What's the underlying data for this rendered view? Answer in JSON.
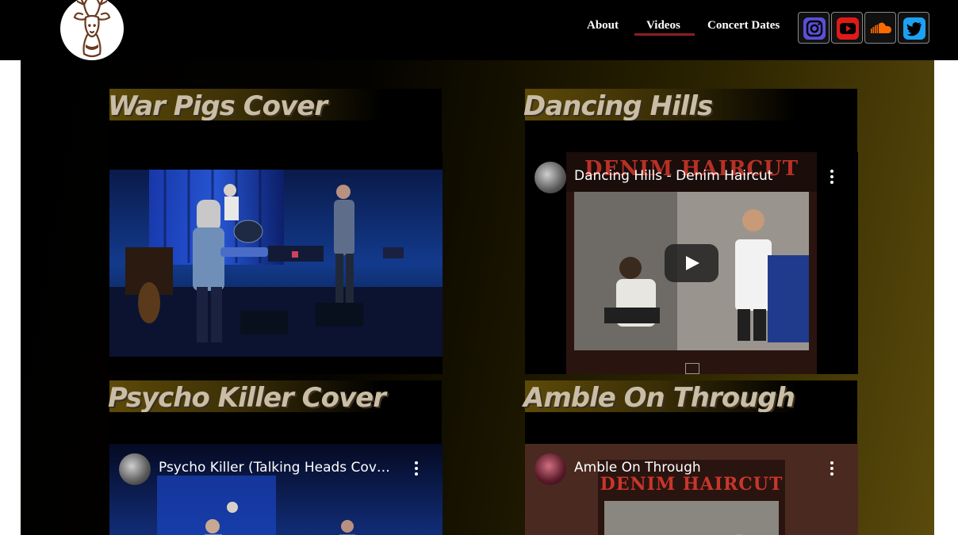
{
  "nav": {
    "items": [
      {
        "label": "About"
      },
      {
        "label": "Videos"
      },
      {
        "label": "Concert Dates"
      }
    ],
    "active": "Videos",
    "accent": "#8f1d22"
  },
  "social": [
    {
      "name": "instagram-icon",
      "color": "#5b4fd6"
    },
    {
      "name": "youtube-icon",
      "color": "#e01a1a"
    },
    {
      "name": "soundcloud-icon",
      "color": "#ff6a00"
    },
    {
      "name": "twitter-icon",
      "color": "#1da1f2"
    }
  ],
  "videos": [
    {
      "title": "War Pigs Cover"
    },
    {
      "title": "Dancing Hills",
      "video_title": "Dancing Hills - Denim Haircut",
      "thumb_brand": "DENIM HAIRCUT"
    },
    {
      "title": "Psycho Killer Cover",
      "video_title": "Psycho Killer (Talking Heads Cover)..."
    },
    {
      "title": "Amble On Through",
      "video_title": "Amble On Through",
      "thumb_brand": "DENIM HAIRCUT"
    }
  ]
}
